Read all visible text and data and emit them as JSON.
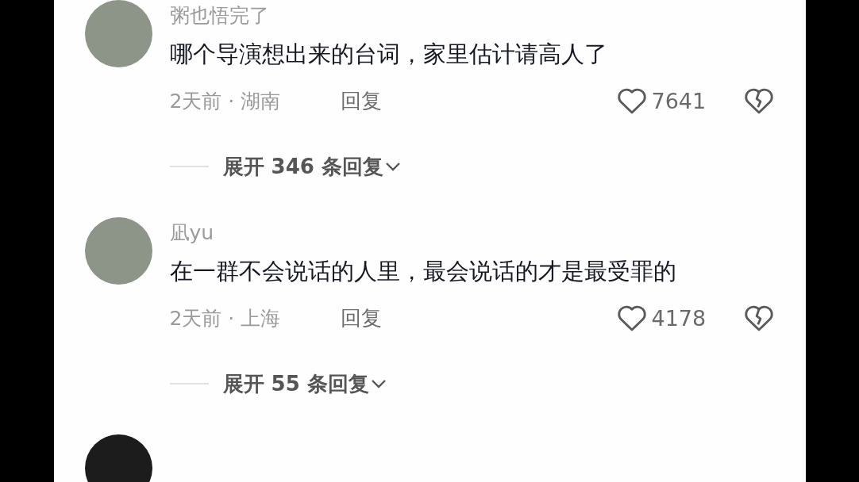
{
  "comments": [
    {
      "username": "粥也悟完了",
      "text": "哪个导演想出来的台词，家里估计请高人了",
      "meta": "2天前 · 湖南",
      "reply": "回复",
      "likes": "7641",
      "expand": "展开 346 条回复"
    },
    {
      "username": "凪yu",
      "text": "在一群不会说话的人里，最会说话的才是最受罪的",
      "meta": "2天前 · 上海",
      "reply": "回复",
      "likes": "4178",
      "expand": "展开 55 条回复"
    }
  ]
}
